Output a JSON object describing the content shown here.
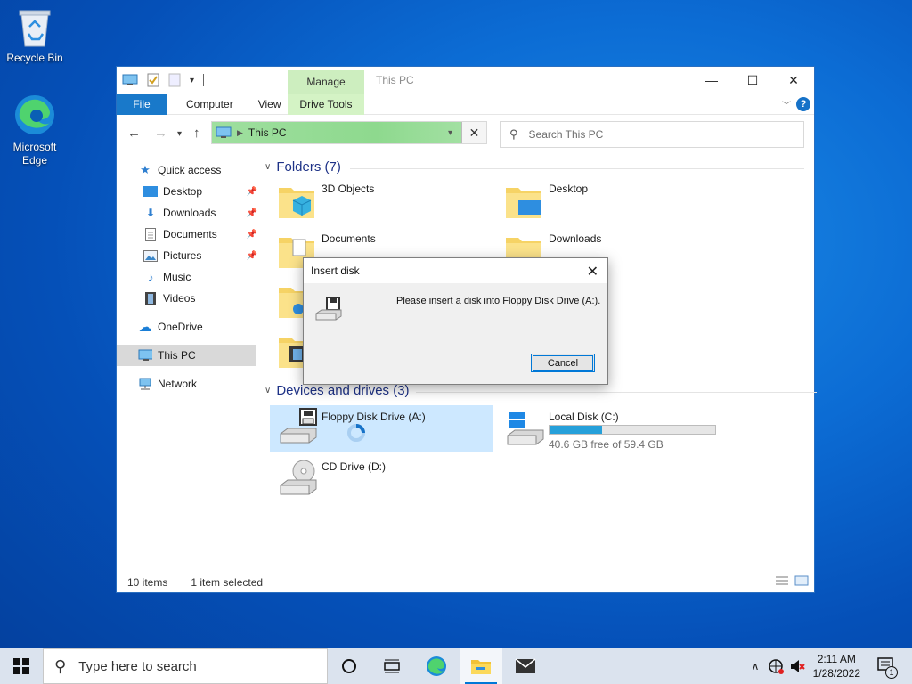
{
  "desktop": {
    "icons": [
      {
        "label": "Recycle Bin"
      },
      {
        "label": "Microsoft Edge"
      }
    ]
  },
  "window": {
    "title": "This PC",
    "ribbon": {
      "context_label": "Manage",
      "tabs": [
        "File",
        "Computer",
        "View",
        "Drive Tools"
      ]
    },
    "address": "This PC",
    "search_placeholder": "Search This PC",
    "nav": {
      "quick_access": "Quick access",
      "items": [
        "Desktop",
        "Downloads",
        "Documents",
        "Pictures",
        "Music",
        "Videos"
      ],
      "onedrive": "OneDrive",
      "this_pc": "This PC",
      "network": "Network"
    },
    "folders_header": "Folders (7)",
    "folders": [
      "3D Objects",
      "Desktop",
      "Documents",
      "Downloads"
    ],
    "devices_header": "Devices and drives (3)",
    "drives": {
      "floppy": "Floppy Disk Drive (A:)",
      "local_name": "Local Disk (C:)",
      "local_free": "40.6 GB free of 59.4 GB",
      "local_used_fraction": 0.316,
      "cd": "CD Drive (D:)"
    },
    "status": {
      "items": "10 items",
      "selected": "1 item selected"
    }
  },
  "dialog": {
    "title": "Insert disk",
    "message": "Please insert a disk into Floppy Disk Drive (A:).",
    "cancel": "Cancel"
  },
  "taskbar": {
    "search_placeholder": "Type here to search",
    "time": "2:11 AM",
    "date": "1/28/2022",
    "notification_count": "1"
  }
}
